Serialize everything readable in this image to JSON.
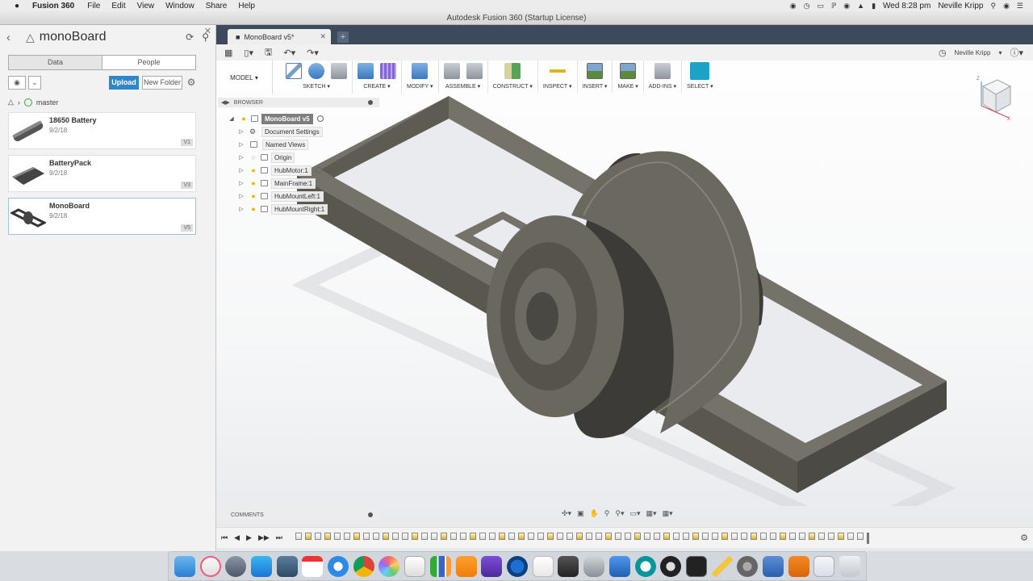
{
  "menubar": {
    "app_name": "Fusion 360",
    "items": [
      "File",
      "Edit",
      "View",
      "Window",
      "Share",
      "Help"
    ],
    "clock": "Wed 8:28 pm",
    "user": "Neville Kripp"
  },
  "window": {
    "title": "Autodesk Fusion 360 (Startup License)"
  },
  "data_panel": {
    "project": "monoBoard",
    "tabs": [
      "Data",
      "People"
    ],
    "upload_label": "Upload",
    "new_folder_label": "New Folder",
    "branch": "master",
    "files": [
      {
        "name": "18650 Battery",
        "date": "9/2/18",
        "version": "V1"
      },
      {
        "name": "BatteryPack",
        "date": "9/2/18",
        "version": "V3"
      },
      {
        "name": "MonoBoard",
        "date": "9/2/18",
        "version": "V5"
      }
    ]
  },
  "document": {
    "tab_title": "MonoBoard v5*",
    "user": "Neville Kripp"
  },
  "ribbon": {
    "workspace": "MODEL",
    "groups": [
      "SKETCH",
      "CREATE",
      "MODIFY",
      "ASSEMBLE",
      "CONSTRUCT",
      "INSPECT",
      "INSERT",
      "MAKE",
      "ADD-INS",
      "SELECT"
    ]
  },
  "browser": {
    "header": "BROWSER",
    "root": "MonoBoard v5",
    "items": [
      "Document Settings",
      "Named Views",
      "Origin",
      "HubMotor:1",
      "MainFrame:1",
      "HubMountLeft:1",
      "HubMountRight:1"
    ]
  },
  "comments": {
    "label": "COMMENTS"
  },
  "colors": {
    "frame": "#6f6c61",
    "accent": "#2e87c9",
    "tabstrip": "#3c4a5c"
  }
}
